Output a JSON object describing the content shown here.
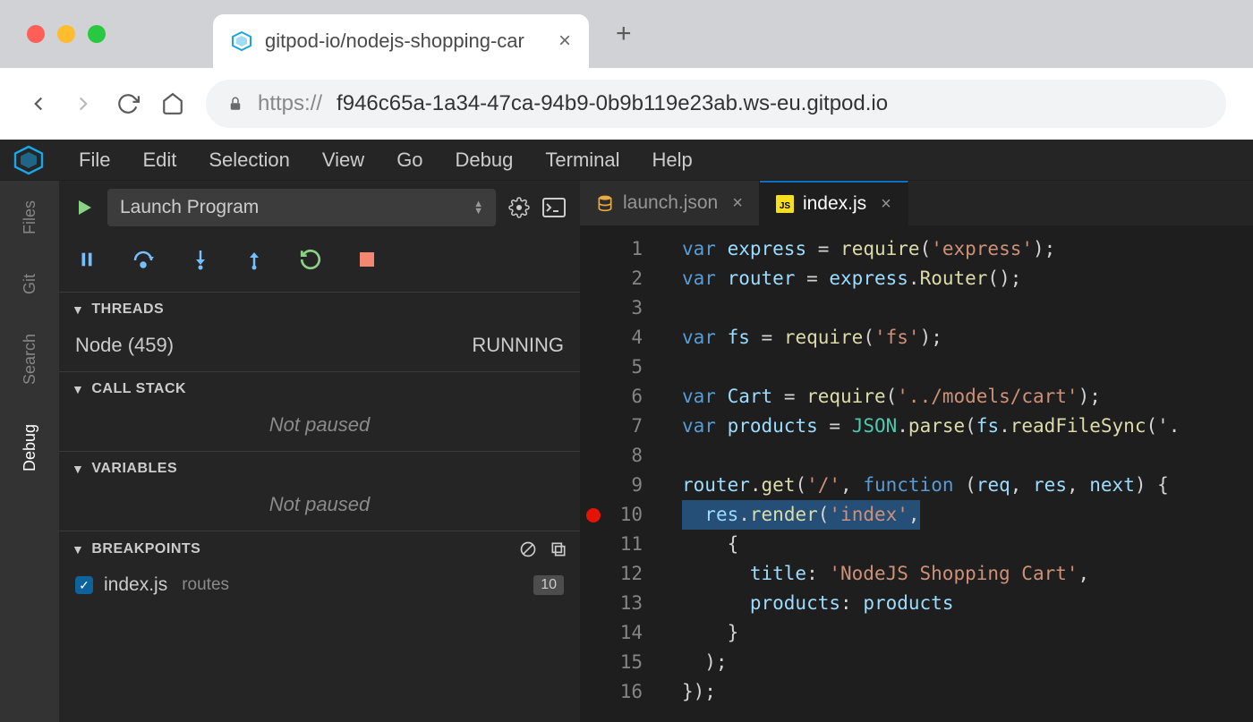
{
  "browser": {
    "tab_title": "gitpod-io/nodejs-shopping-car",
    "url_protocol": "https://",
    "url_host": "f946c65a-1a34-47ca-94b9-0b9b119e23ab.ws-eu.gitpod.io"
  },
  "menubar": [
    "File",
    "Edit",
    "Selection",
    "View",
    "Go",
    "Debug",
    "Terminal",
    "Help"
  ],
  "activity": {
    "items": [
      "Files",
      "Git",
      "Search",
      "Debug"
    ],
    "active": "Debug"
  },
  "debug": {
    "config": "Launch Program",
    "sections": {
      "threads": {
        "title": "THREADS",
        "thread_name": "Node (459)",
        "thread_status": "RUNNING"
      },
      "callstack": {
        "title": "CALL STACK",
        "empty": "Not paused"
      },
      "variables": {
        "title": "VARIABLES",
        "empty": "Not paused"
      },
      "breakpoints": {
        "title": "BREAKPOINTS",
        "item_file": "index.js",
        "item_folder": "routes",
        "item_line": "10"
      }
    }
  },
  "editor": {
    "tabs": [
      {
        "label": "launch.json",
        "icon": "db",
        "active": false
      },
      {
        "label": "index.js",
        "icon": "js",
        "active": true
      }
    ],
    "code": {
      "lines": [
        {
          "n": 1,
          "segs": [
            {
              "c": "tok-kw",
              "t": "var"
            },
            {
              "t": " "
            },
            {
              "c": "tok-var",
              "t": "express"
            },
            {
              "t": " = "
            },
            {
              "c": "tok-fn",
              "t": "require"
            },
            {
              "t": "("
            },
            {
              "c": "tok-str",
              "t": "'express'"
            },
            {
              "t": ");"
            }
          ]
        },
        {
          "n": 2,
          "segs": [
            {
              "c": "tok-kw",
              "t": "var"
            },
            {
              "t": " "
            },
            {
              "c": "tok-var",
              "t": "router"
            },
            {
              "t": " = "
            },
            {
              "c": "tok-var",
              "t": "express"
            },
            {
              "t": "."
            },
            {
              "c": "tok-fn",
              "t": "Router"
            },
            {
              "t": "();"
            }
          ]
        },
        {
          "n": 3,
          "segs": []
        },
        {
          "n": 4,
          "segs": [
            {
              "c": "tok-kw",
              "t": "var"
            },
            {
              "t": " "
            },
            {
              "c": "tok-var",
              "t": "fs"
            },
            {
              "t": " = "
            },
            {
              "c": "tok-fn",
              "t": "require"
            },
            {
              "t": "("
            },
            {
              "c": "tok-str",
              "t": "'fs'"
            },
            {
              "t": ");"
            }
          ]
        },
        {
          "n": 5,
          "segs": []
        },
        {
          "n": 6,
          "segs": [
            {
              "c": "tok-kw",
              "t": "var"
            },
            {
              "t": " "
            },
            {
              "c": "tok-var",
              "t": "Cart"
            },
            {
              "t": " = "
            },
            {
              "c": "tok-fn",
              "t": "require"
            },
            {
              "t": "("
            },
            {
              "c": "tok-str",
              "t": "'../models/cart'"
            },
            {
              "t": ");"
            }
          ]
        },
        {
          "n": 7,
          "segs": [
            {
              "c": "tok-kw",
              "t": "var"
            },
            {
              "t": " "
            },
            {
              "c": "tok-var",
              "t": "products"
            },
            {
              "t": " = "
            },
            {
              "c": "tok-type",
              "t": "JSON"
            },
            {
              "t": "."
            },
            {
              "c": "tok-fn",
              "t": "parse"
            },
            {
              "t": "("
            },
            {
              "c": "tok-var",
              "t": "fs"
            },
            {
              "t": "."
            },
            {
              "c": "tok-fn",
              "t": "readFileSync"
            },
            {
              "t": "('."
            }
          ]
        },
        {
          "n": 8,
          "segs": []
        },
        {
          "n": 9,
          "segs": [
            {
              "c": "tok-var",
              "t": "router"
            },
            {
              "t": "."
            },
            {
              "c": "tok-fn",
              "t": "get"
            },
            {
              "t": "("
            },
            {
              "c": "tok-str",
              "t": "'/'"
            },
            {
              "t": ", "
            },
            {
              "c": "tok-kw",
              "t": "function"
            },
            {
              "t": " ("
            },
            {
              "c": "tok-var",
              "t": "req"
            },
            {
              "t": ", "
            },
            {
              "c": "tok-var",
              "t": "res"
            },
            {
              "t": ", "
            },
            {
              "c": "tok-var",
              "t": "next"
            },
            {
              "t": ") {"
            }
          ]
        },
        {
          "n": 10,
          "bp": true,
          "hl": true,
          "segs": [
            {
              "t": "  "
            },
            {
              "c": "tok-var",
              "t": "res"
            },
            {
              "t": "."
            },
            {
              "c": "tok-fn",
              "t": "render"
            },
            {
              "t": "("
            },
            {
              "c": "tok-str",
              "t": "'index'"
            },
            {
              "t": ","
            }
          ]
        },
        {
          "n": 11,
          "segs": [
            {
              "t": "    {"
            }
          ]
        },
        {
          "n": 12,
          "segs": [
            {
              "t": "      "
            },
            {
              "c": "tok-prop",
              "t": "title"
            },
            {
              "t": ": "
            },
            {
              "c": "tok-str",
              "t": "'NodeJS Shopping Cart'"
            },
            {
              "t": ","
            }
          ]
        },
        {
          "n": 13,
          "segs": [
            {
              "t": "      "
            },
            {
              "c": "tok-prop",
              "t": "products"
            },
            {
              "t": ": "
            },
            {
              "c": "tok-var",
              "t": "products"
            }
          ]
        },
        {
          "n": 14,
          "segs": [
            {
              "t": "    }"
            }
          ]
        },
        {
          "n": 15,
          "segs": [
            {
              "t": "  );"
            }
          ]
        },
        {
          "n": 16,
          "segs": [
            {
              "t": "});"
            }
          ]
        }
      ]
    }
  }
}
